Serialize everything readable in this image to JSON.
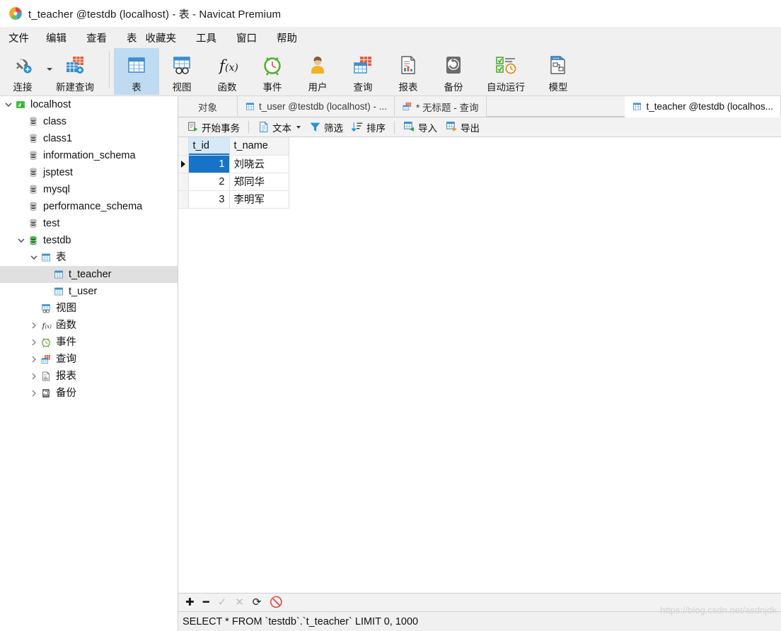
{
  "window": {
    "title": "t_teacher @testdb (localhost) - 表 - Navicat Premium",
    "logo_icon": "navicat-logo-icon"
  },
  "menubar": {
    "items": [
      {
        "label": "文件",
        "name": "menu-file"
      },
      {
        "label": "编辑",
        "name": "menu-edit"
      },
      {
        "label": "查看",
        "name": "menu-view"
      },
      {
        "label": "表",
        "name": "menu-table"
      },
      {
        "label": "收藏夹",
        "name": "menu-favorites"
      },
      {
        "label": "工具",
        "name": "menu-tools"
      },
      {
        "label": "窗口",
        "name": "menu-window"
      },
      {
        "label": "帮助",
        "name": "menu-help"
      }
    ]
  },
  "toolbar": {
    "buttons": [
      {
        "label": "连接",
        "icon": "connection-icon",
        "active": false,
        "has_caret": true
      },
      {
        "label": "新建查询",
        "icon": "new-query-icon",
        "active": false,
        "has_caret": false
      },
      {
        "label": "表",
        "icon": "table-icon",
        "active": true,
        "has_caret": false
      },
      {
        "label": "视图",
        "icon": "view-icon",
        "active": false,
        "has_caret": false
      },
      {
        "label": "函数",
        "icon": "function-icon",
        "active": false,
        "has_caret": false
      },
      {
        "label": "事件",
        "icon": "event-icon",
        "active": false,
        "has_caret": false
      },
      {
        "label": "用户",
        "icon": "user-icon",
        "active": false,
        "has_caret": false
      },
      {
        "label": "查询",
        "icon": "query-icon",
        "active": false,
        "has_caret": false
      },
      {
        "label": "报表",
        "icon": "report-icon",
        "active": false,
        "has_caret": false
      },
      {
        "label": "备份",
        "icon": "backup-icon",
        "active": false,
        "has_caret": false
      },
      {
        "label": "自动运行",
        "icon": "automation-icon",
        "active": false,
        "has_caret": false
      },
      {
        "label": "模型",
        "icon": "model-icon",
        "active": false,
        "has_caret": false
      }
    ]
  },
  "sidebar": {
    "nodes": [
      {
        "label": "localhost",
        "icon": "server-icon",
        "indent": 0,
        "twisty": "expanded",
        "selected": false
      },
      {
        "label": "class",
        "icon": "database-icon",
        "indent": 1,
        "twisty": "none",
        "selected": false
      },
      {
        "label": "class1",
        "icon": "database-icon",
        "indent": 1,
        "twisty": "none",
        "selected": false
      },
      {
        "label": "information_schema",
        "icon": "database-icon",
        "indent": 1,
        "twisty": "none",
        "selected": false
      },
      {
        "label": "jsptest",
        "icon": "database-icon",
        "indent": 1,
        "twisty": "none",
        "selected": false
      },
      {
        "label": "mysql",
        "icon": "database-icon",
        "indent": 1,
        "twisty": "none",
        "selected": false
      },
      {
        "label": "performance_schema",
        "icon": "database-icon",
        "indent": 1,
        "twisty": "none",
        "selected": false
      },
      {
        "label": "test",
        "icon": "database-icon",
        "indent": 1,
        "twisty": "none",
        "selected": false
      },
      {
        "label": "testdb",
        "icon": "database-open-icon",
        "indent": 1,
        "twisty": "expanded",
        "selected": false
      },
      {
        "label": "表",
        "icon": "table-icon",
        "indent": 2,
        "twisty": "expanded",
        "selected": false
      },
      {
        "label": "t_teacher",
        "icon": "table-icon",
        "indent": 3,
        "twisty": "none",
        "selected": true
      },
      {
        "label": "t_user",
        "icon": "table-icon",
        "indent": 3,
        "twisty": "none",
        "selected": false
      },
      {
        "label": "视图",
        "icon": "view-icon",
        "indent": 2,
        "twisty": "none",
        "selected": false
      },
      {
        "label": "函数",
        "icon": "function-icon",
        "indent": 2,
        "twisty": "collapsed",
        "selected": false
      },
      {
        "label": "事件",
        "icon": "event-icon",
        "indent": 2,
        "twisty": "collapsed",
        "selected": false
      },
      {
        "label": "查询",
        "icon": "query-icon",
        "indent": 2,
        "twisty": "collapsed",
        "selected": false
      },
      {
        "label": "报表",
        "icon": "report-icon",
        "indent": 2,
        "twisty": "collapsed",
        "selected": false
      },
      {
        "label": "备份",
        "icon": "backup-icon",
        "indent": 2,
        "twisty": "collapsed",
        "selected": false
      }
    ]
  },
  "tabs": {
    "objects_label": "对象",
    "items": [
      {
        "label": "t_user @testdb (localhost) - ...",
        "icon": "table-icon",
        "active": false
      },
      {
        "label": "* 无标题 - 查询",
        "icon": "query-icon",
        "active": false
      },
      {
        "label": "t_teacher @testdb (localhos...",
        "icon": "table-icon",
        "active": true
      }
    ]
  },
  "data_toolbar": {
    "buttons": [
      {
        "label": "开始事务",
        "icon": "begin-transaction-icon",
        "caret": false
      },
      {
        "label": "文本",
        "icon": "text-icon",
        "caret": true
      },
      {
        "label": "筛选",
        "icon": "filter-icon",
        "caret": false
      },
      {
        "label": "排序",
        "icon": "sort-icon",
        "caret": false
      },
      {
        "label": "导入",
        "icon": "import-icon",
        "caret": false
      },
      {
        "label": "导出",
        "icon": "export-icon",
        "caret": false
      }
    ]
  },
  "grid": {
    "columns": [
      {
        "label": "t_id",
        "selected": true
      },
      {
        "label": "t_name",
        "selected": false
      }
    ],
    "rows": [
      {
        "current": true,
        "t_id": "1",
        "t_name": "刘晓云",
        "id_selected": true
      },
      {
        "current": false,
        "t_id": "2",
        "t_name": "郑同华",
        "id_selected": false
      },
      {
        "current": false,
        "t_id": "3",
        "t_name": "李明军",
        "id_selected": false
      }
    ]
  },
  "grid_nav": {
    "buttons": [
      {
        "icon": "add-record-icon",
        "glyph": "✚",
        "disabled": false
      },
      {
        "icon": "delete-record-icon",
        "glyph": "━",
        "disabled": false
      },
      {
        "icon": "apply-change-icon",
        "glyph": "✓",
        "disabled": true
      },
      {
        "icon": "cancel-change-icon",
        "glyph": "✕",
        "disabled": true
      },
      {
        "icon": "refresh-icon",
        "glyph": "⟳",
        "disabled": false
      },
      {
        "icon": "stop-icon",
        "glyph": "🚫",
        "disabled": false
      }
    ]
  },
  "statusbar": {
    "query": "SELECT * FROM `testdb`.`t_teacher` LIMIT 0, 1000"
  },
  "watermark": {
    "text": "https://blog.csdn.net/asdnjdk"
  },
  "colors": {
    "accent_blue": "#1673c8",
    "active_toolbar": "#bfdbf2",
    "header_bg": "#f4f4f4",
    "selection_gray": "#e0e0e0"
  }
}
